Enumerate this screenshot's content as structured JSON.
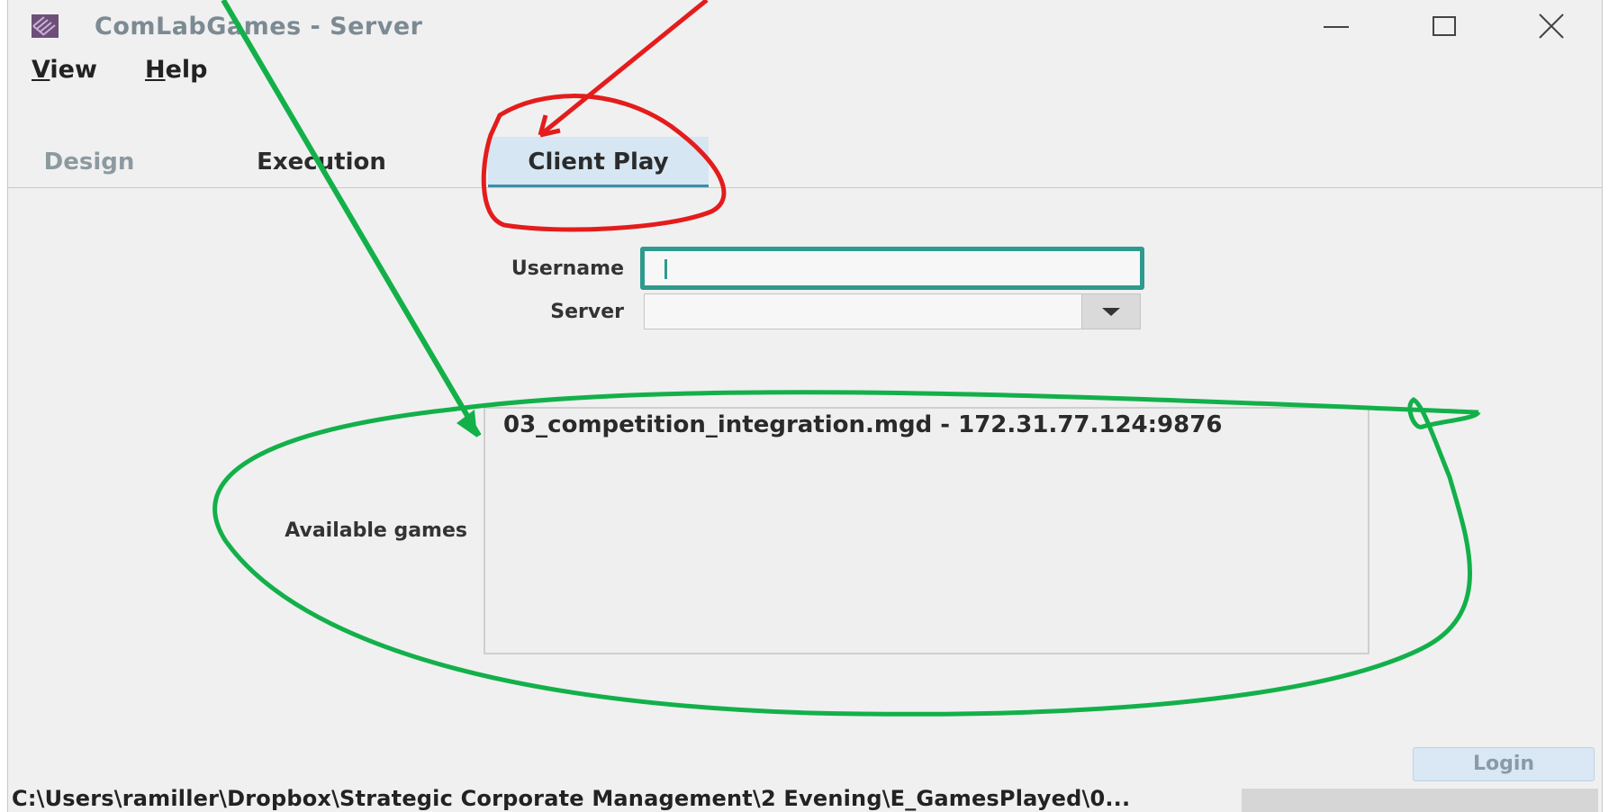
{
  "window": {
    "title": "ComLabGames - Server"
  },
  "menu": {
    "items": [
      {
        "label": "View"
      },
      {
        "label": "Help"
      }
    ]
  },
  "tabs": [
    {
      "label": "Design",
      "state": "disabled"
    },
    {
      "label": "Execution",
      "state": "normal"
    },
    {
      "label": "Client Play",
      "state": "selected"
    }
  ],
  "form": {
    "username_label": "Username",
    "username_value": "",
    "server_label": "Server",
    "server_value": "",
    "available_games_label": "Available games",
    "games": [
      "03_competition_integration.mgd - 172.31.77.124:9876"
    ],
    "login_label": "Login"
  },
  "status": {
    "path": "C:\\Users\\ramiller\\Dropbox\\Strategic Corporate Management\\2 Evening\\E_GamesPlayed\\0..."
  },
  "colors": {
    "window_bg": "#f0f0f0",
    "accent_teal": "#2f9a8e",
    "selected_tab_bg": "#d6e6f2",
    "annotation_red": "#e41c1c",
    "annotation_green": "#13b04a"
  },
  "icons": {
    "app": "comlabgames-logo-icon",
    "minimize": "minimize-icon",
    "maximize": "maximize-icon",
    "close": "close-icon",
    "dropdown": "chevron-down-icon"
  }
}
